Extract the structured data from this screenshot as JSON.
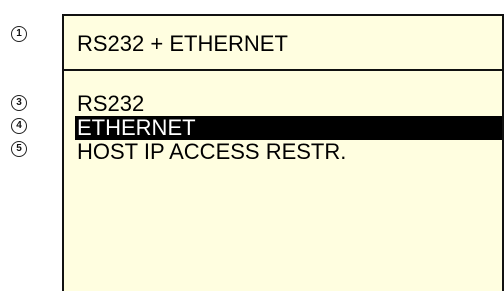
{
  "callouts": {
    "c1": "1",
    "c3": "3",
    "c4": "4",
    "c5": "5"
  },
  "screen": {
    "title": "RS232 + ETHERNET",
    "background_color": "#fffee0",
    "menu": [
      {
        "label": "RS232",
        "selected": false
      },
      {
        "label": "ETHERNET",
        "selected": true
      },
      {
        "label": "HOST IP ACCESS RESTR.",
        "selected": false
      }
    ]
  }
}
